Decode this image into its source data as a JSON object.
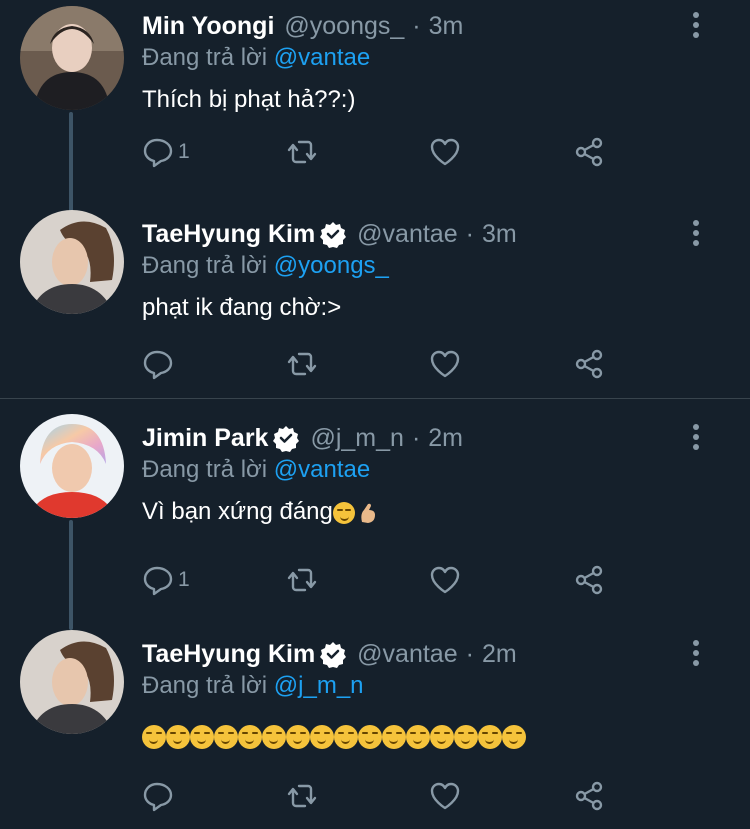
{
  "colors": {
    "background": "#15202b",
    "mention": "#1da1f2",
    "muted": "#8899a6",
    "verified": "#ffffff"
  },
  "reply_prefix": "Đang trả lời",
  "tweets": [
    {
      "name": "Min Yoongi",
      "handle": "@yoongs_",
      "time": "3m",
      "reply_to": "@vantae",
      "text": "Thích bị phạt hả??:)",
      "reply_count": "1",
      "verified": false
    },
    {
      "name": "TaeHyung Kim",
      "handle": "@vantae",
      "time": "3m",
      "reply_to": "@yoongs_",
      "text": "phạt ik đang chờ:>",
      "reply_count": "",
      "verified": true
    },
    {
      "name": "Jimin Park",
      "handle": "@j_m_n",
      "time": "2m",
      "reply_to": "@vantae",
      "text": "Vì bạn xứng đáng",
      "emoji": [
        "smirking-face",
        "pinching-hand"
      ],
      "reply_count": "1",
      "verified": true
    },
    {
      "name": "TaeHyung Kim",
      "handle": "@vantae",
      "time": "2m",
      "reply_to": "@j_m_n",
      "text": "",
      "emoji_repeat": {
        "name": "smirking-face",
        "count": 16
      },
      "reply_count": "",
      "verified": true
    }
  ]
}
